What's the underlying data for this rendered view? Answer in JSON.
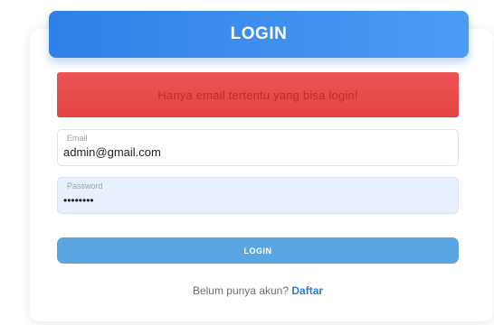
{
  "header": {
    "title": "LOGIN"
  },
  "alert": {
    "message": "Hanya email tertentu yang bisa login!"
  },
  "form": {
    "email": {
      "label": "Email",
      "value": "admin@gmail.com"
    },
    "password": {
      "label": "Password",
      "value": "••••••••"
    },
    "submit_label": "LOGIN"
  },
  "footer": {
    "prompt": "Belum punya akun?",
    "link_label": "Daftar"
  },
  "colors": {
    "header_blue": "#2f80e8",
    "alert_red": "#e24444",
    "button_blue": "#5aa6e2",
    "link_blue": "#2a7bd6"
  }
}
